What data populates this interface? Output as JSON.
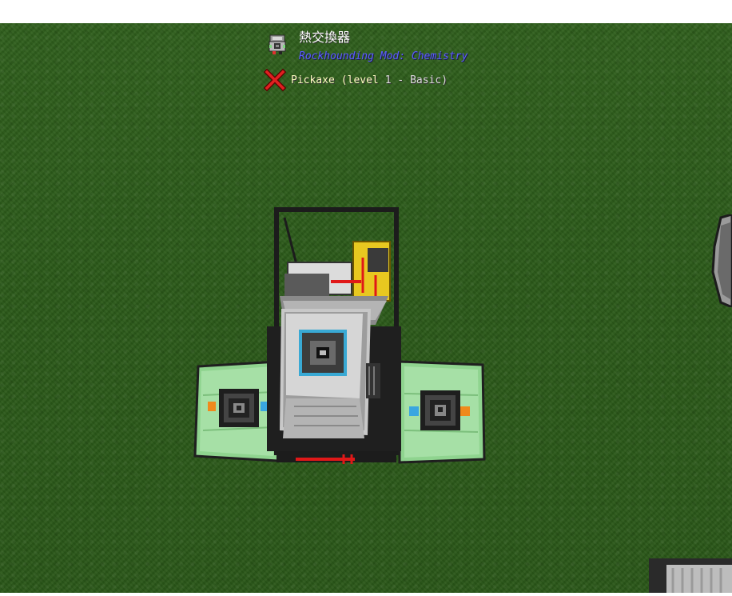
{
  "tooltip": {
    "block_name": "熱交換器",
    "mod_name": "Rockhounding Mod: Chemistry",
    "tool_name": "Pickaxe",
    "tool_level_prefix": "(level",
    "tool_level_value": "1 - Basic)",
    "tool_status_icon": "red-x-icon",
    "block_icon": "heat-exchanger-icon"
  },
  "colors": {
    "grass": "#2d5c1b",
    "title": "#ffffff",
    "mod_name": "#5b5bff",
    "tool_name": "#ffffc0",
    "tool_level": "#dcdcdc",
    "status_x": "#e02020"
  }
}
